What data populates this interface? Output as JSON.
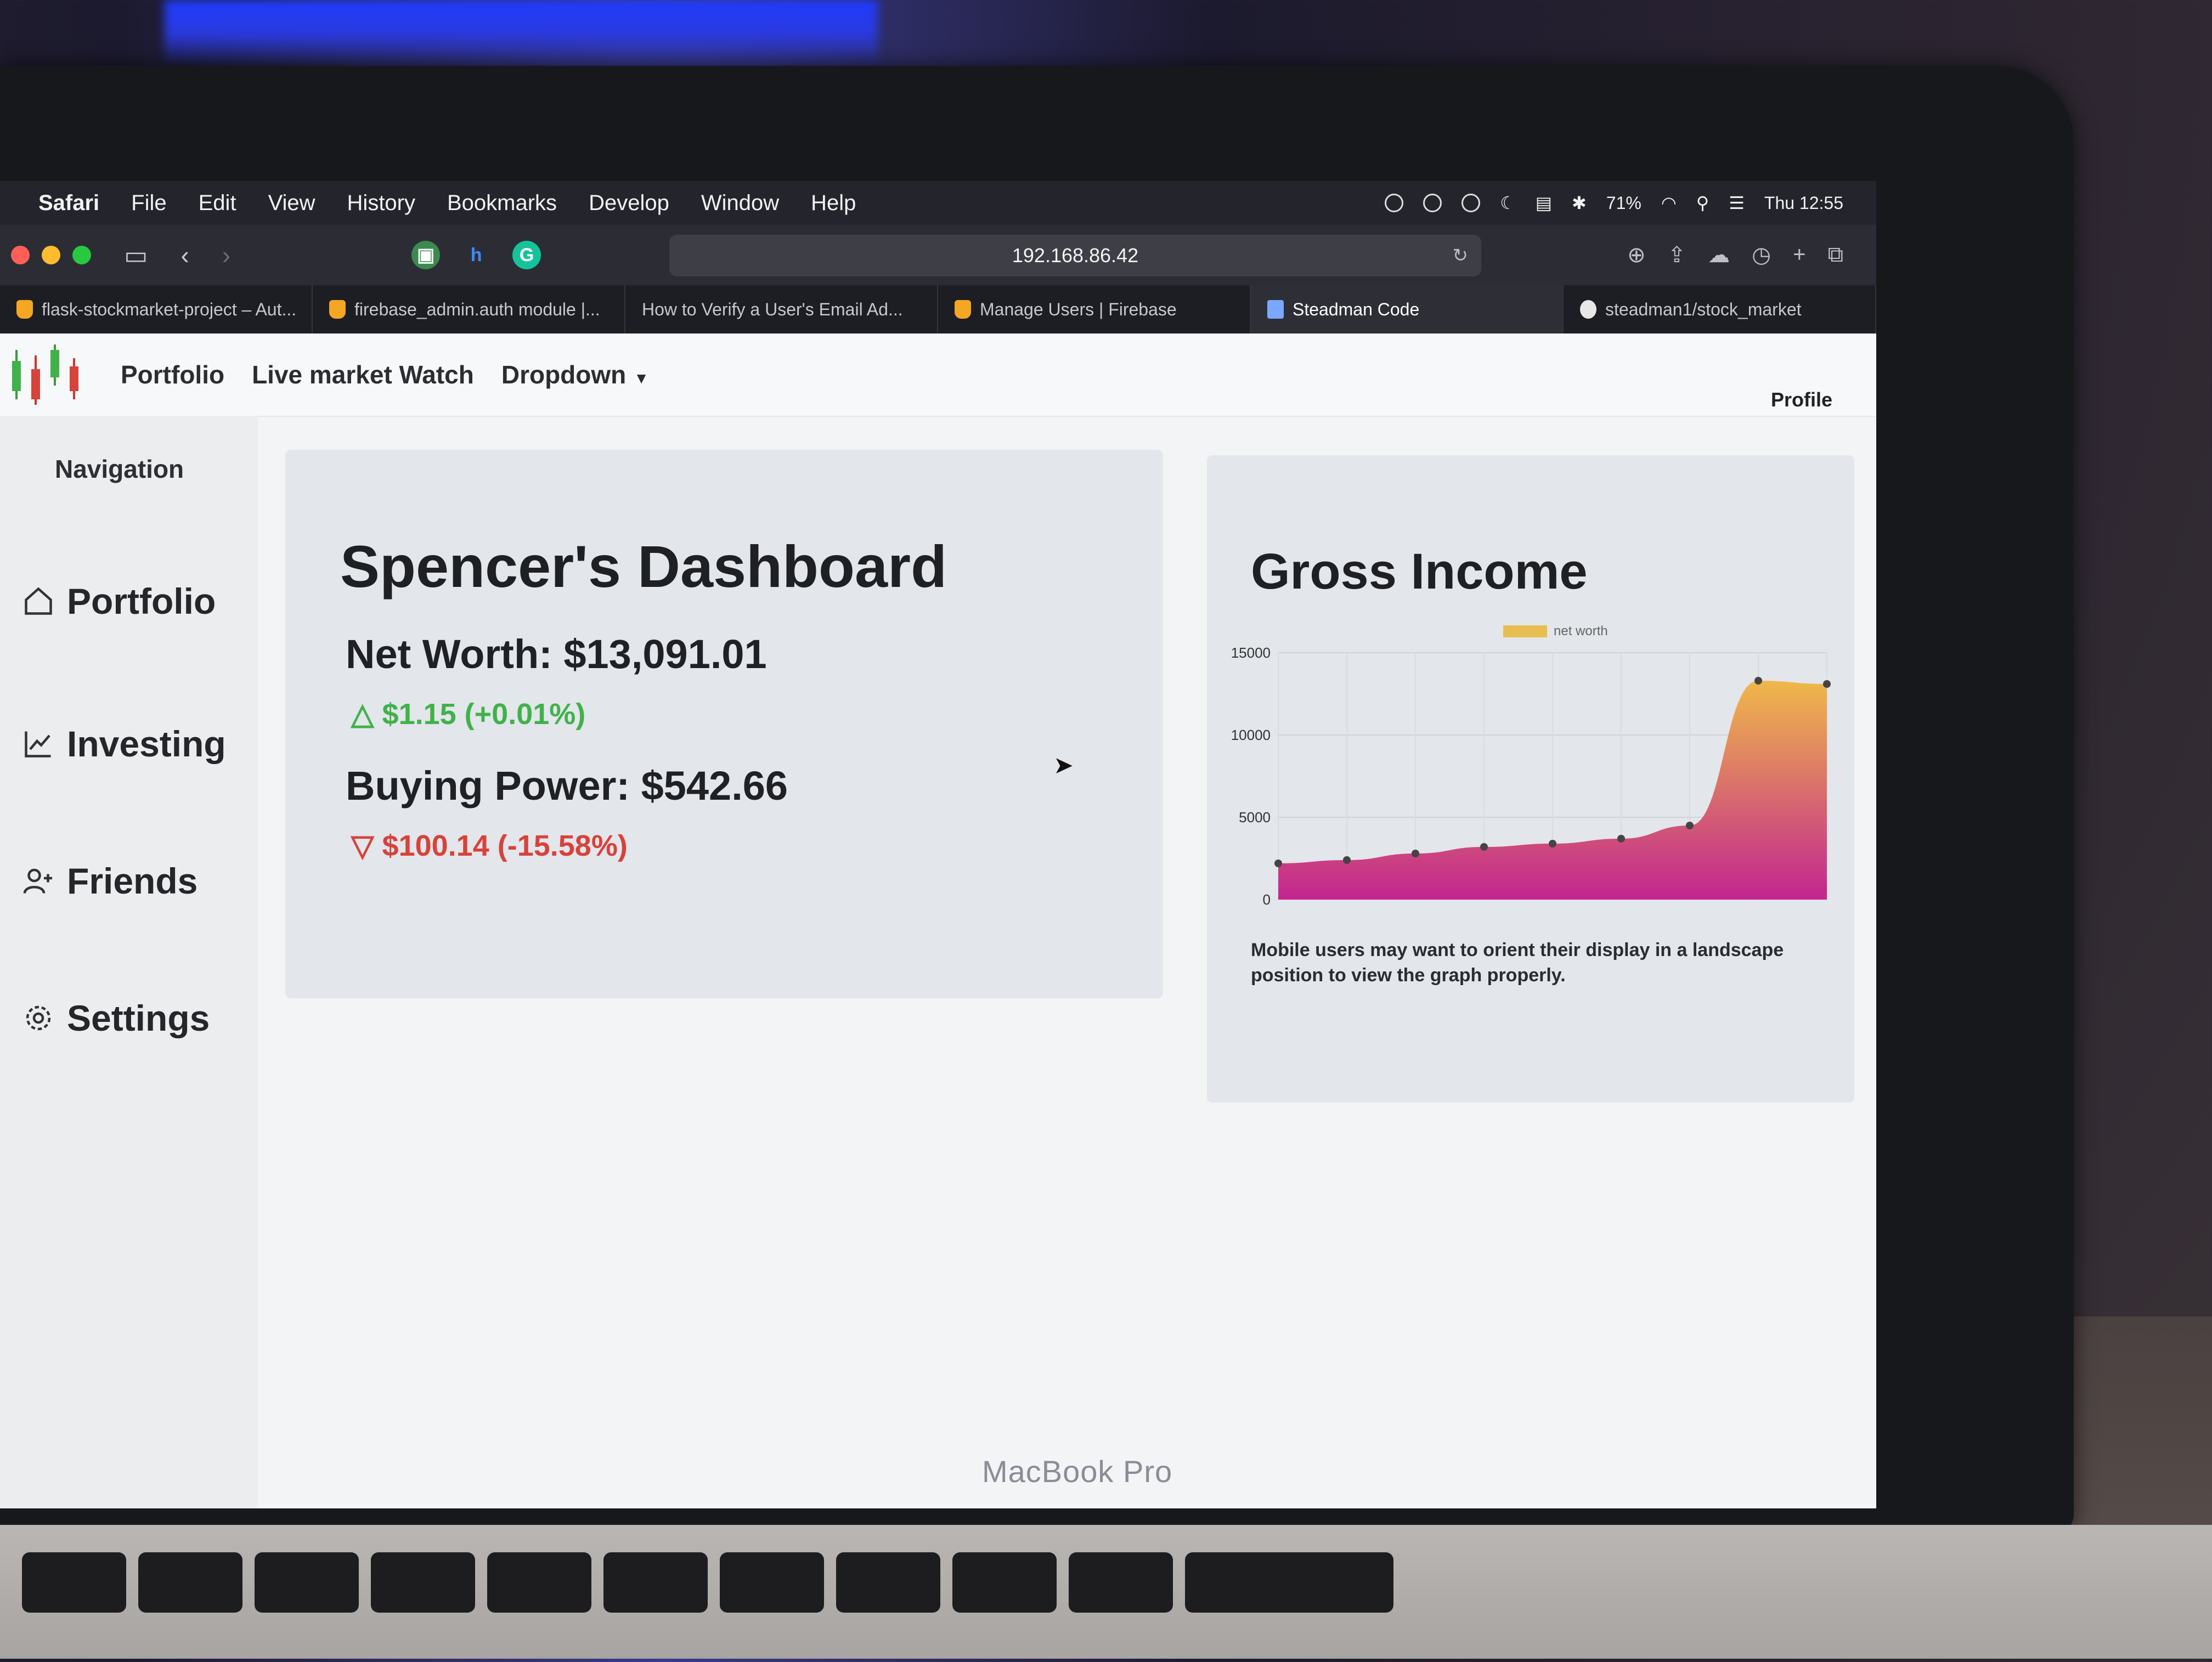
{
  "menubar": {
    "app": "Safari",
    "items": [
      "File",
      "Edit",
      "View",
      "History",
      "Bookmarks",
      "Develop",
      "Window",
      "Help"
    ],
    "battery": "71%",
    "clock": "Thu 12:55"
  },
  "toolbar": {
    "address": "192.168.86.42"
  },
  "tabs": [
    {
      "label": "flask-stockmarket-project – Aut...",
      "icon": "firebase-icon"
    },
    {
      "label": "firebase_admin.auth module |...",
      "icon": "firebase-icon"
    },
    {
      "label": "How to Verify a User's Email Ad...",
      "icon": "none"
    },
    {
      "label": "Manage Users | Firebase",
      "icon": "firebase-icon"
    },
    {
      "label": "Steadman Code",
      "icon": "window-icon"
    },
    {
      "label": "steadman1/stock_market",
      "icon": "github-icon"
    }
  ],
  "navbar": {
    "links": [
      "Portfolio",
      "Live market Watch",
      "Dropdown"
    ],
    "profile": "Profile"
  },
  "sidebar": {
    "title": "Navigation",
    "items": [
      {
        "label": "Portfolio",
        "icon": "home-icon"
      },
      {
        "label": "Investing",
        "icon": "trend-chart-icon"
      },
      {
        "label": "Friends",
        "icon": "add-user-icon"
      },
      {
        "label": "Settings",
        "icon": "gear-icon"
      }
    ]
  },
  "dashboard": {
    "title": "Spencer's Dashboard",
    "net_worth": "Net Worth: $13,091.01",
    "net_worth_change": "$1.15 (+0.01%)",
    "buying_power": "Buying Power: $542.66",
    "buying_power_change": "$100.14 (-15.58%)",
    "colors": {
      "up": "#3fb24a",
      "down": "#d7423b"
    }
  },
  "income": {
    "title": "Gross Income",
    "note": "Mobile users may want to orient their display in a landscape position to view the graph properly."
  },
  "chart_data": {
    "type": "area",
    "title": "Gross Income",
    "legend": "top",
    "grid": true,
    "ylim": [
      0,
      15000
    ],
    "yticks": [
      0,
      5000,
      10000,
      15000
    ],
    "series": [
      {
        "name": "net worth",
        "values": [
          2200,
          2400,
          2800,
          3200,
          3400,
          3700,
          4500,
          13300,
          13100
        ]
      }
    ],
    "gradient": [
      "#c2258f",
      "#f0b84a"
    ]
  }
}
